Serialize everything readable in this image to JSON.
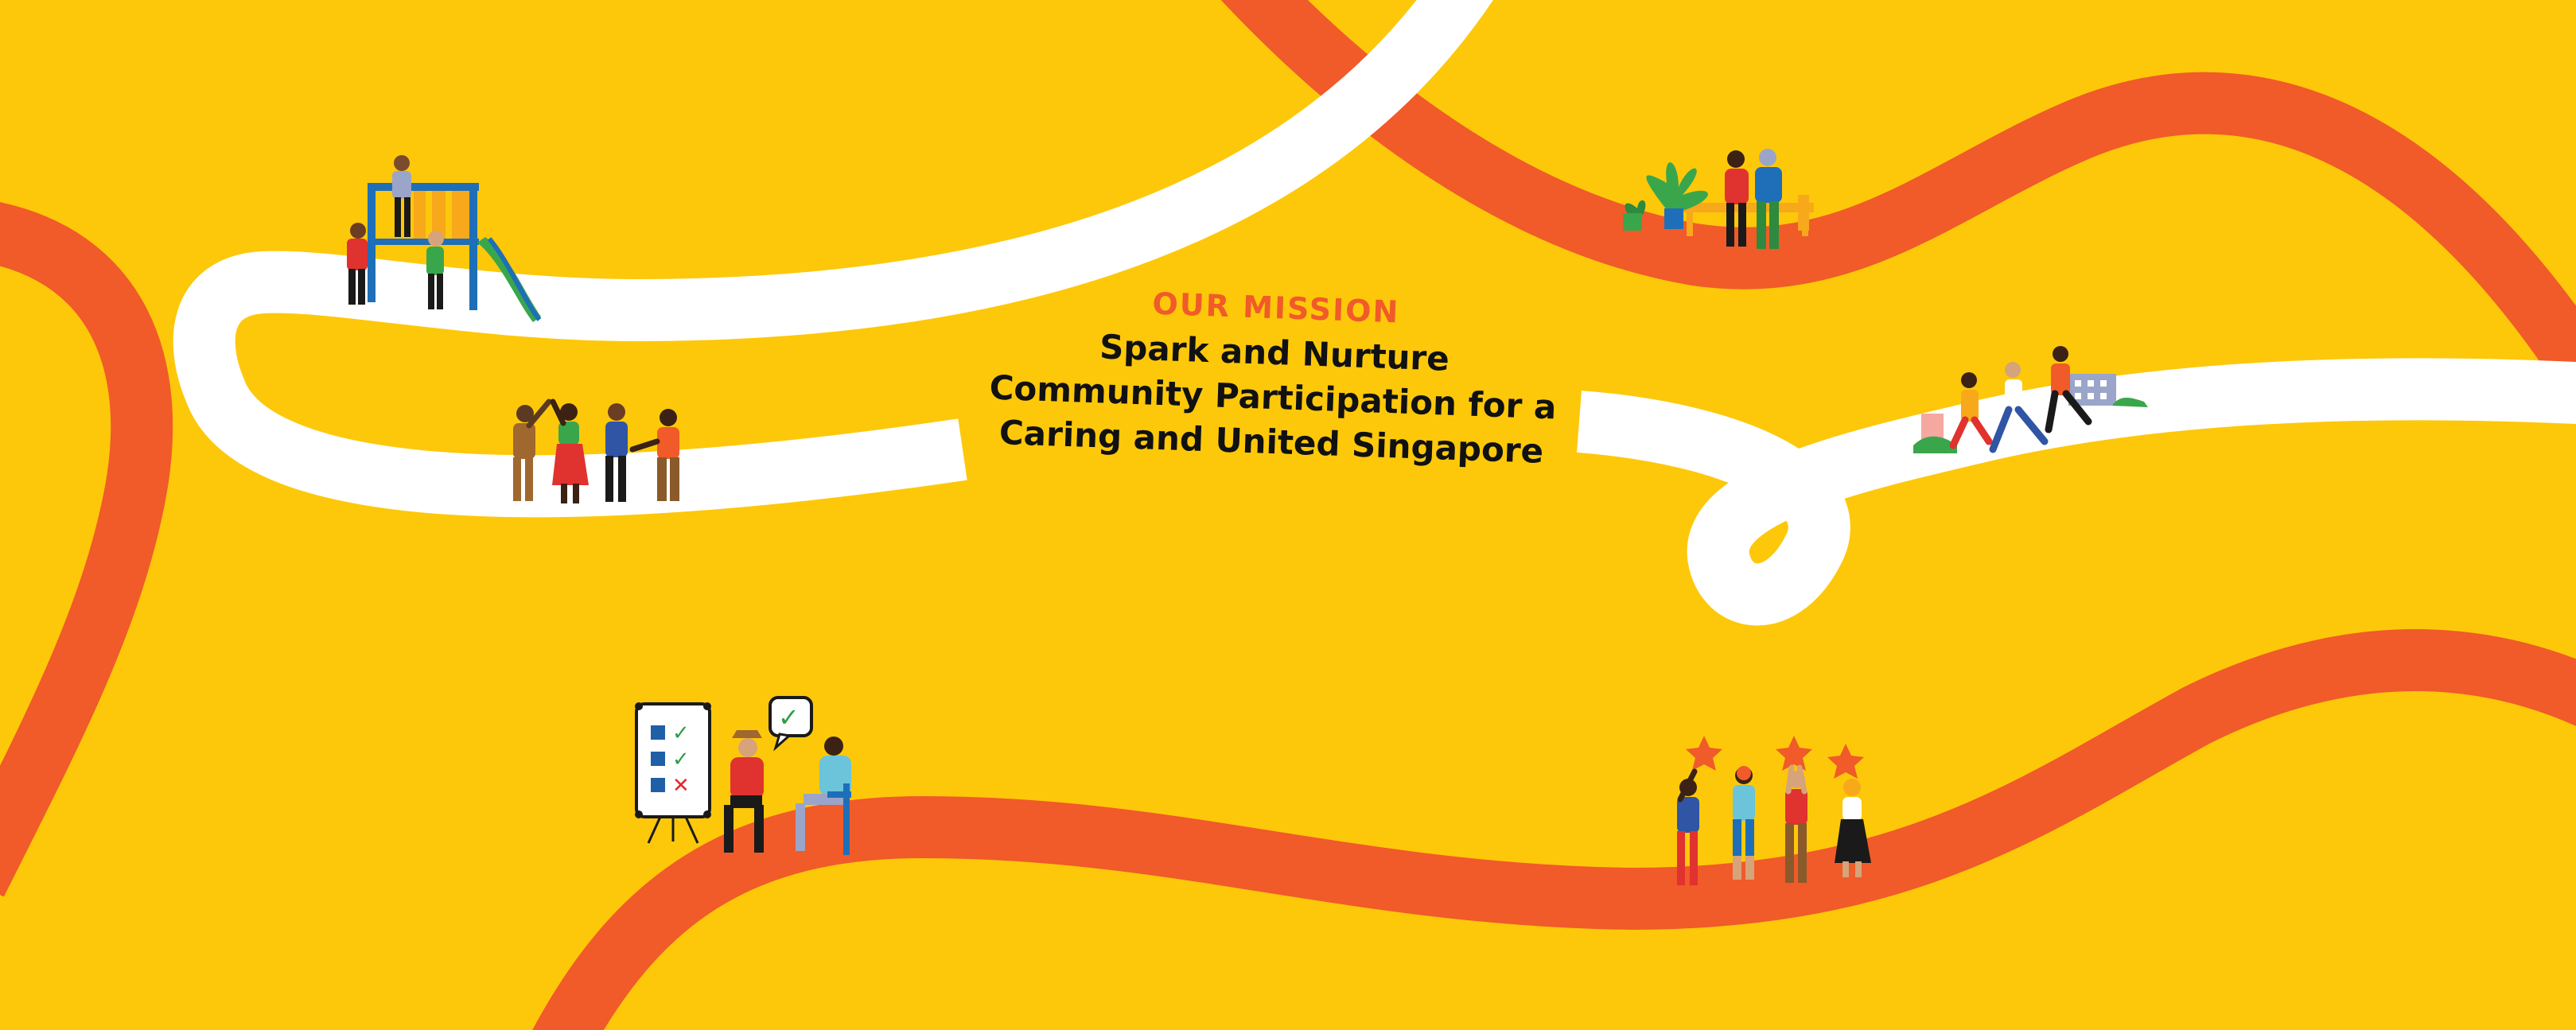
{
  "mission": {
    "heading": "OUR MISSION",
    "line1": "Spark and Nurture",
    "line2": "Community Participation for a",
    "line3": "Caring and United Singapore"
  },
  "checklist": {
    "row1_mark": "✓",
    "row2_mark": "✓",
    "row3_mark": "✕"
  },
  "speech_bubble_mark": "✓",
  "colors": {
    "background": "#fdc80a",
    "orange_path": "#f15a29",
    "white_path": "#ffffff",
    "heading": "#f15a29",
    "text": "#111111",
    "check_green": "#2e9e45",
    "cross_red": "#e3262c",
    "checklist_box": "#1f5fa8"
  },
  "illustrations": [
    "playground-group-icon",
    "high-five-group-icon",
    "plants-and-couple-icon",
    "running-group-icon",
    "checklist-meeting-icon",
    "star-holders-group-icon"
  ]
}
